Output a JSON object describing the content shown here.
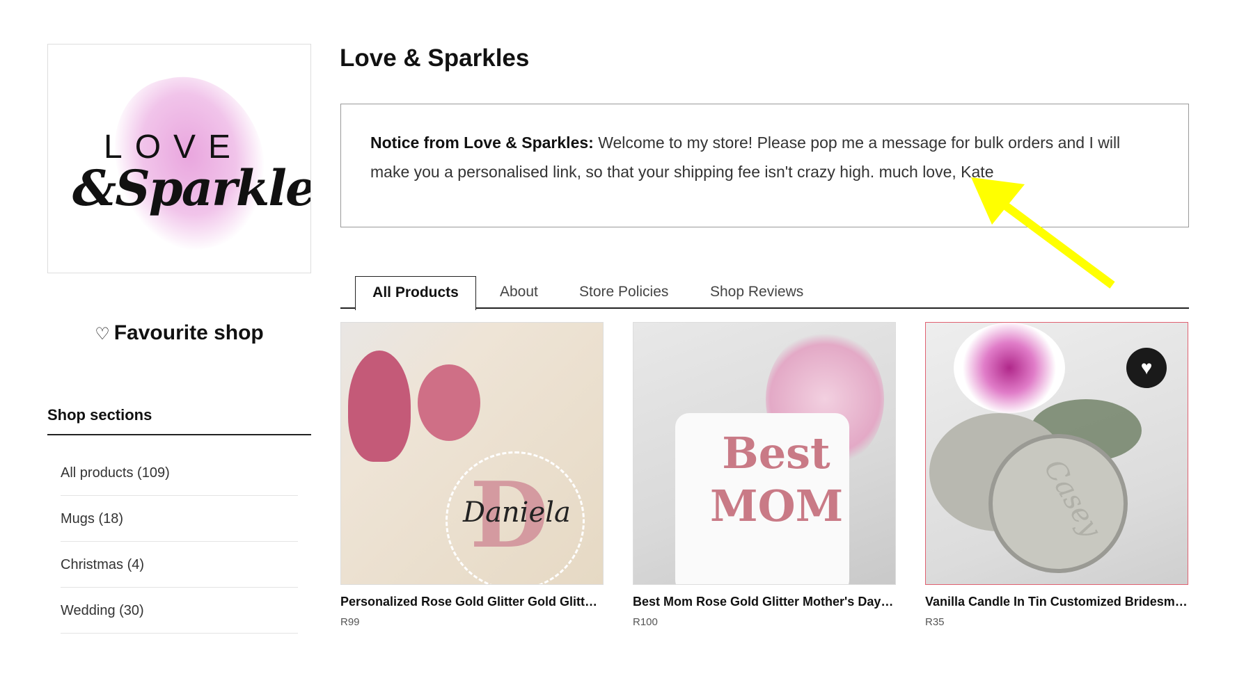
{
  "shop": {
    "logo_text": "LOVE & Sparkles",
    "title": "Love & Sparkles",
    "notice_label": "Notice from Love & Sparkles:",
    "notice_text": " Welcome to my store! Please pop me a message for bulk orders and I will make you a personalised link, so that your shipping fee isn't crazy high. much love, Kate"
  },
  "sidebar": {
    "favourite_icon": "heart-outline-icon",
    "favourite_label": "Favourite shop",
    "sections_title": "Shop sections",
    "sections": [
      {
        "label": "All products (109)"
      },
      {
        "label": "Mugs (18)"
      },
      {
        "label": "Christmas (4)"
      },
      {
        "label": "Wedding (30)"
      }
    ]
  },
  "tabs": [
    {
      "label": "All Products",
      "active": true
    },
    {
      "label": "About"
    },
    {
      "label": "Store Policies"
    },
    {
      "label": "Shop Reviews"
    }
  ],
  "products": [
    {
      "name": "Personalized Rose Gold Glitter Gold Glitter E...",
      "price": "R99",
      "image_text": "Daniela"
    },
    {
      "name": "Best Mom Rose Gold Glitter Mother's Day Gi...",
      "price": "R100",
      "image_text": "Best MOM"
    },
    {
      "name": "Vanilla Candle In Tin Customized Bridesmai...",
      "price": "R35",
      "image_text": "Casey",
      "favourite_icon": "heart-filled-icon"
    }
  ],
  "annotation": {
    "arrow_color": "#ffff00"
  },
  "colors": {
    "selected_card_border": "#e06070"
  }
}
